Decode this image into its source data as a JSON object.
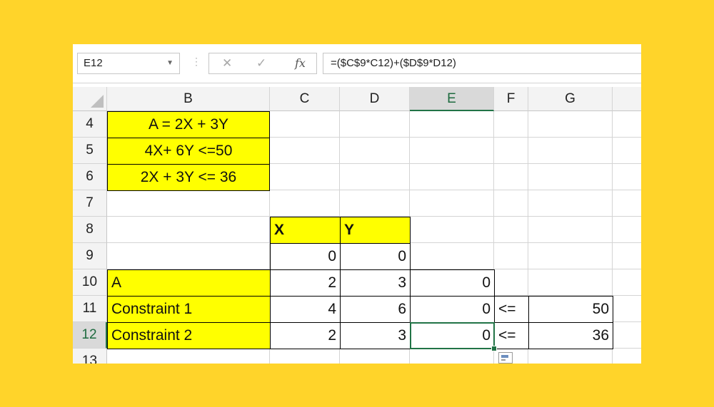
{
  "name_box": {
    "value": "E12"
  },
  "formula_bar": {
    "cancel_icon": "close-icon",
    "enter_icon": "check-icon",
    "fx_label": "fx",
    "formula": "=($C$9*C12)+($D$9*D12)"
  },
  "columns": [
    "B",
    "C",
    "D",
    "E",
    "F",
    "G"
  ],
  "active_column": "E",
  "rows": [
    "4",
    "5",
    "6",
    "7",
    "8",
    "9",
    "10",
    "11",
    "12",
    "13"
  ],
  "active_row": "12",
  "cells": {
    "b4": "A = 2X + 3Y",
    "b5": "4X+ 6Y <=50",
    "b6": "2X + 3Y <= 36",
    "c8": "X",
    "d8": "Y",
    "c9": "0",
    "d9": "0",
    "b10": "A",
    "c10": "2",
    "d10": "3",
    "e10": "0",
    "b11": "Constraint 1",
    "c11": "4",
    "d11": "6",
    "e11": "0",
    "f11": "<=",
    "g11": "50",
    "b12": "Constraint 2",
    "c12": "2",
    "d12": "3",
    "e12": "0",
    "f12": "<=",
    "g12": "36"
  },
  "colors": {
    "highlight": "#ffff00",
    "selection": "#217346",
    "background": "#FFD42A"
  }
}
